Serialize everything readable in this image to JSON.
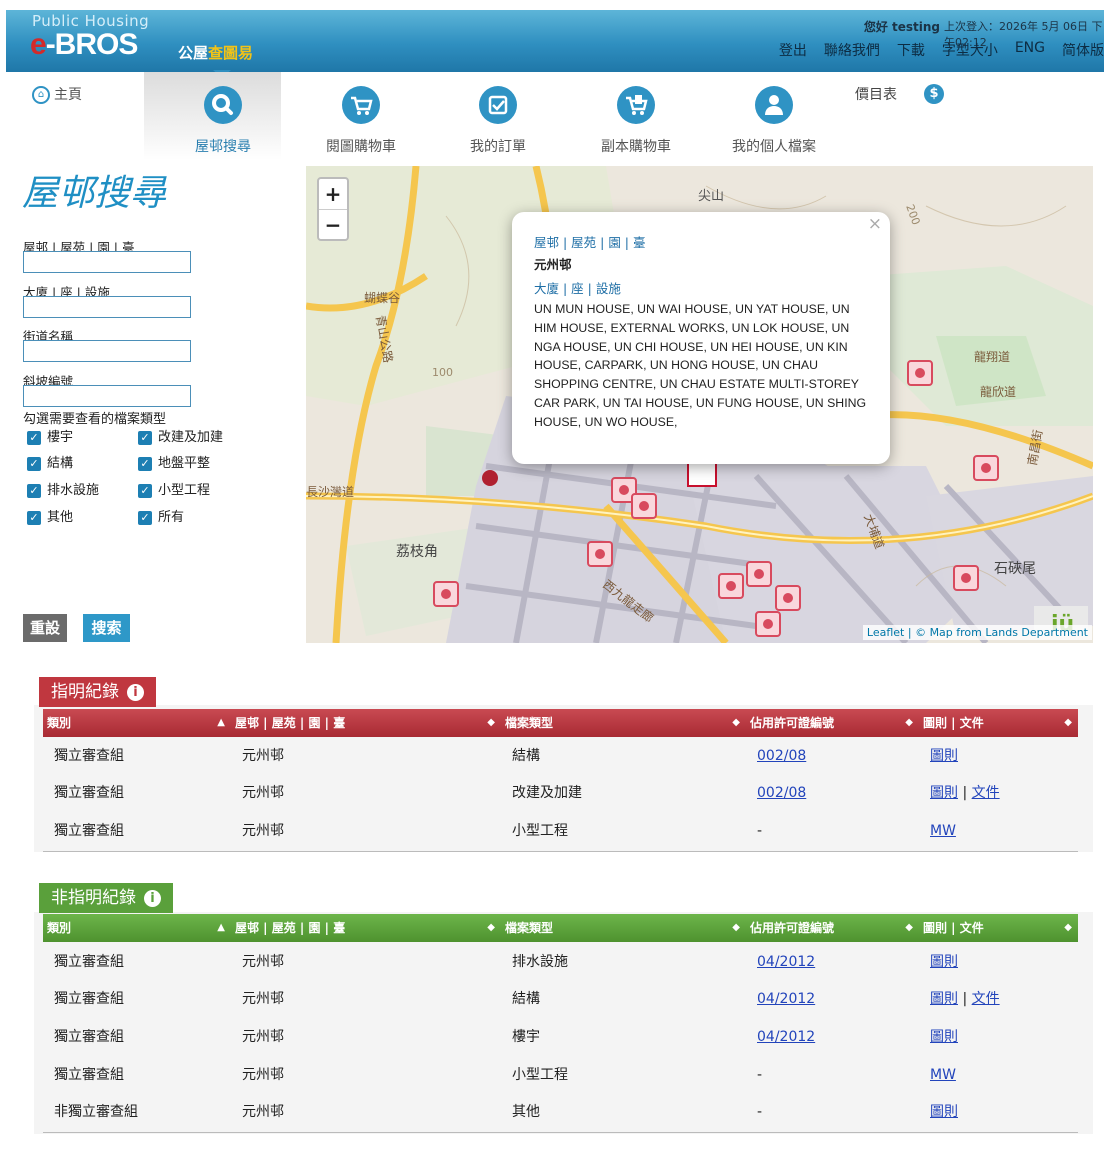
{
  "header": {
    "brand_small": "Public Housing",
    "brand_e": "e",
    "brand_rest": "-BROS",
    "brand_zh_a": "公屋",
    "brand_zh_b": "查圖易",
    "greeting": "您好 testing",
    "last_login": "上次登入：2026年 5月 06日 下午02:12",
    "links": [
      "登出",
      "聯絡我們",
      "下載",
      "字型大小",
      "ENG",
      "简体版"
    ]
  },
  "nav": {
    "home": "主頁",
    "items": [
      {
        "label": "屋邨搜尋",
        "icon": "search-icon",
        "glyph": "⚲"
      },
      {
        "label": "閱圖購物車",
        "icon": "cart-icon",
        "glyph": "🛒"
      },
      {
        "label": "我的訂單",
        "icon": "order-icon",
        "glyph": "✔"
      },
      {
        "label": "副本購物車",
        "icon": "copy-cart-icon",
        "glyph": "⎘"
      },
      {
        "label": "我的個人檔案",
        "icon": "user-icon",
        "glyph": "👤"
      }
    ],
    "price_list": "價目表",
    "dollar": "$"
  },
  "search": {
    "title": "屋邨搜尋",
    "fields": [
      "屋邨 | 屋苑 | 園 | 臺",
      "大廈 | 座 | 設施",
      "街道名稱",
      "斜坡編號"
    ],
    "check_title": "勾選需要查看的檔案類型",
    "checkboxes": [
      "樓宇",
      "改建及加建",
      "結構",
      "地盤平整",
      "排水設施",
      "小型工程",
      "其他",
      "所有"
    ],
    "reset": "重設",
    "submit": "搜索"
  },
  "map": {
    "zoom_in": "+",
    "zoom_out": "−",
    "labels": [
      "尖山",
      "蝴蝶谷",
      "荔枝角",
      "石硤尾",
      "龍翔道",
      "龍欣道",
      "長沙灣道",
      "西九龍走廊",
      "大埔道",
      "青山公路",
      "南昌街",
      "100",
      "200"
    ],
    "popup": {
      "close": "×",
      "estate_label": "屋邨 | 屋苑 | 園 | 臺",
      "estate": "元州邨",
      "block_label": "大廈 | 座 | 設施",
      "blocks": "UN MUN HOUSE, UN WAI HOUSE, UN YAT HOUSE, UN HIM HOUSE, EXTERNAL WORKS, UN LOK HOUSE, UN NGA HOUSE, UN CHI HOUSE, UN HEI HOUSE, UN KIN HOUSE, CARPARK, UN HONG HOUSE, UN CHAU SHOPPING CENTRE, UN CHAU ESTATE MULTI-STOREY CAR PARK, UN TAI HOUSE, UN FUNG HOUSE, UN SHING HOUSE, UN WO HOUSE,"
    },
    "attribution": "Leaflet | © Map from Lands Department"
  },
  "designated": {
    "title": "指明紀錄",
    "color": "#c0373f",
    "headers": [
      "類別",
      "屋邨 | 屋苑 | 園 | 臺",
      "檔案類型",
      "佔用許可證編號",
      "圖則 | 文件"
    ],
    "rows": [
      {
        "cat": "獨立審查組",
        "estate": "元州邨",
        "type": "結構",
        "permit": "002/08",
        "docs": [
          "圖則"
        ]
      },
      {
        "cat": "獨立審查組",
        "estate": "元州邨",
        "type": "改建及加建",
        "permit": "002/08",
        "docs": [
          "圖則",
          "文件"
        ]
      },
      {
        "cat": "獨立審查組",
        "estate": "元州邨",
        "type": "小型工程",
        "permit": "-",
        "docs": [
          "MW"
        ]
      }
    ]
  },
  "non_designated": {
    "title": "非指明紀錄",
    "color": "#5aa03b",
    "headers": [
      "類別",
      "屋邨 | 屋苑 | 園 | 臺",
      "檔案類型",
      "佔用許可證編號",
      "圖則 | 文件"
    ],
    "rows": [
      {
        "cat": "獨立審查組",
        "estate": "元州邨",
        "type": "排水設施",
        "permit": "04/2012",
        "docs": [
          "圖則"
        ]
      },
      {
        "cat": "獨立審查組",
        "estate": "元州邨",
        "type": "結構",
        "permit": "04/2012",
        "docs": [
          "圖則",
          "文件"
        ]
      },
      {
        "cat": "獨立審查組",
        "estate": "元州邨",
        "type": "樓宇",
        "permit": "04/2012",
        "docs": [
          "圖則"
        ]
      },
      {
        "cat": "獨立審查組",
        "estate": "元州邨",
        "type": "小型工程",
        "permit": "-",
        "docs": [
          "MW"
        ]
      },
      {
        "cat": "非獨立審查組",
        "estate": "元州邨",
        "type": "其他",
        "permit": "-",
        "docs": [
          "圖則"
        ]
      }
    ]
  }
}
